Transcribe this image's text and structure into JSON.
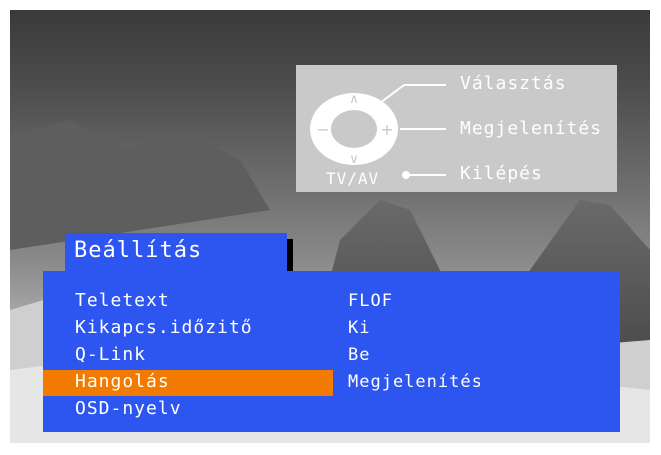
{
  "legend": {
    "select_label": "Választás",
    "display_label": "Megjelenítés",
    "exit_label": "Kilépés",
    "tvav_label": "TV/AV"
  },
  "menu": {
    "title": "Beállítás",
    "items": [
      {
        "label": "Teletext",
        "value": "FLOF"
      },
      {
        "label": "Kikapcs.időzitő",
        "value": "Ki"
      },
      {
        "label": "Q-Link",
        "value": "Be"
      },
      {
        "label": "Hangolás",
        "value": "Megjelenítés",
        "selected": true
      },
      {
        "label": "OSD-nyelv",
        "value": ""
      }
    ]
  },
  "colors": {
    "menu_bg": "#2d55f0",
    "selected_bg": "#f27a00",
    "legend_bg": "#c9c9c9",
    "text": "#ffffff"
  }
}
